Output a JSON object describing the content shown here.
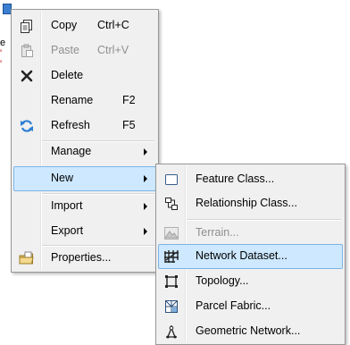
{
  "background": {
    "fragments": [
      "e",
      "'",
      "'"
    ]
  },
  "context_menu": {
    "items": [
      {
        "label": "Copy",
        "shortcut": "Ctrl+C",
        "icon": "copy-icon",
        "disabled": false
      },
      {
        "label": "Paste",
        "shortcut": "Ctrl+V",
        "icon": "paste-icon",
        "disabled": true
      },
      {
        "label": "Delete",
        "shortcut": "",
        "icon": "delete-icon",
        "disabled": false
      },
      {
        "label": "Rename",
        "shortcut": "F2",
        "icon": "",
        "disabled": false
      },
      {
        "label": "Refresh",
        "shortcut": "F5",
        "icon": "refresh-icon",
        "disabled": false
      },
      {
        "label": "Manage",
        "shortcut": "",
        "icon": "",
        "submenu": true
      },
      {
        "label": "New",
        "shortcut": "",
        "icon": "",
        "submenu": true,
        "active": true
      },
      {
        "label": "Import",
        "shortcut": "",
        "icon": "",
        "submenu": true
      },
      {
        "label": "Export",
        "shortcut": "",
        "icon": "",
        "submenu": true
      },
      {
        "label": "Properties...",
        "shortcut": "",
        "icon": "properties-icon"
      }
    ]
  },
  "submenu_new": {
    "items": [
      {
        "label": "Feature Class...",
        "icon": "feature-class-icon"
      },
      {
        "label": "Relationship Class...",
        "icon": "relationship-class-icon"
      },
      {
        "label": "Terrain...",
        "icon": "terrain-icon",
        "disabled": true
      },
      {
        "label": "Network Dataset...",
        "icon": "network-dataset-icon",
        "highlighted": true
      },
      {
        "label": "Topology...",
        "icon": "topology-icon"
      },
      {
        "label": "Parcel Fabric...",
        "icon": "parcel-fabric-icon"
      },
      {
        "label": "Geometric Network...",
        "icon": "geometric-network-icon"
      }
    ]
  },
  "colors": {
    "highlight": "#cde8ff",
    "highlight_border": "#7cb4e8",
    "menu_bg": "#f0f0f0"
  }
}
